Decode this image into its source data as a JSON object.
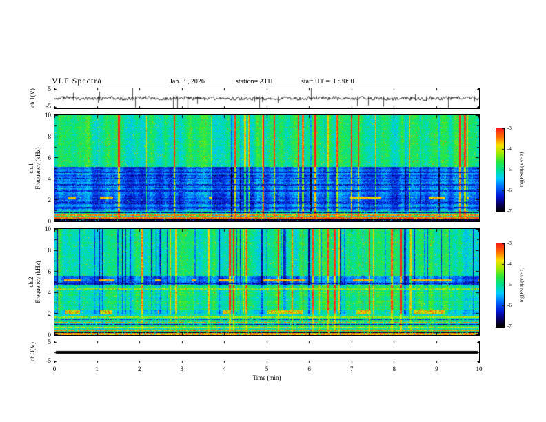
{
  "header": {
    "title": "VLF Spectra",
    "date": "Jan. 3 , 2026",
    "station": "station= ATH",
    "start_ut": "start UT =  1 :30: 0"
  },
  "panels": {
    "ch1_wave": {
      "label": "ch.1(V)",
      "ymax": "5",
      "ymin": "-5"
    },
    "ch1_spec": {
      "label_line1": "ch.1",
      "label_line2": "Frequency (kHz)",
      "yticks": [
        "0",
        "2",
        "4",
        "6",
        "8",
        "10"
      ]
    },
    "ch2_spec": {
      "label_line1": "ch.2",
      "label_line2": "Frequency (kHz)",
      "yticks": [
        "0",
        "2",
        "4",
        "6",
        "8",
        "10"
      ]
    },
    "ch3_wave": {
      "label": "ch.3(V)",
      "ymax": "5",
      "ymin": "-5"
    }
  },
  "xaxis": {
    "label": "Time  (min)",
    "ticks": [
      "0",
      "1",
      "2",
      "3",
      "4",
      "5",
      "6",
      "7",
      "8",
      "9",
      "10"
    ]
  },
  "colorbar": {
    "label": "log(PSD)/(V²/Hz)",
    "ticks": [
      "-3",
      "-4",
      "-5",
      "-6",
      "-7"
    ]
  },
  "chart_data": [
    {
      "type": "line",
      "title": "ch.1(V) time series",
      "xlabel": "Time (min)",
      "xlim": [
        0,
        10
      ],
      "ylabel": "ch.1(V)",
      "ylim": [
        -5,
        5
      ],
      "yticks": [
        5,
        -5
      ],
      "description": "Broadband noise waveform fluctuating around 0 V (roughly ±1 V) with sporadic impulsive vertical spikes toward ±5 V distributed across the full 10-minute record."
    },
    {
      "type": "heatmap",
      "title": "ch.1 spectrogram",
      "xlabel": "Time (min)",
      "xlim": [
        0,
        10
      ],
      "ylabel": "Frequency (kHz)",
      "ylim": [
        0,
        10
      ],
      "yticks": [
        0,
        2,
        4,
        6,
        8,
        10
      ],
      "zlabel": "log(PSD)/(V²/Hz)",
      "zlim": [
        -7,
        -3
      ],
      "colormap": "rainbow: black (-7) → blue → cyan → green → yellow → red (-3)",
      "description": "Background PSD near -4.5 (green/cyan speckle) above ~5 kHz with dense vertical yellow impulsive streaks (sferics); depressed band near -6 (blue with horizontal striations) from ~1–5 kHz; intermittent reddish patches near 2.2 kHz; narrow intense red lines (~-3) near 0.3–0.6 kHz and a near-black line (~-7) at the bottom edge."
    },
    {
      "type": "heatmap",
      "title": "ch.2 spectrogram",
      "xlabel": "Time (min)",
      "xlim": [
        0,
        10
      ],
      "ylabel": "Frequency (kHz)",
      "ylim": [
        0,
        10
      ],
      "yticks": [
        0,
        2,
        4,
        6,
        8,
        10
      ],
      "zlabel": "log(PSD)/(V²/Hz)",
      "zlim": [
        -7,
        -3
      ],
      "colormap": "rainbow: black (-7) → blue → cyan → green → yellow → red (-3)",
      "description": "Green/cyan background (~-4.5) above ~5.5 kHz crossed by many narrow blue vertical streaks; red interference line near 5 kHz over a darker band; yellow line near 4.3 kHz; thick intermittent dark-red/maroon patches near 2 kHz; below 2 kHz alternating horizontal lines of yellow, red (~-3), green and near-black (~-7)."
    },
    {
      "type": "line",
      "title": "ch.3(V) time series",
      "xlabel": "Time (min)",
      "xlim": [
        0,
        10
      ],
      "ylabel": "ch.3(V)",
      "ylim": [
        -5,
        5
      ],
      "yticks": [
        5,
        -5
      ],
      "description": "Constant flat thick line at 0 V for the entire record (inactive channel)."
    }
  ]
}
